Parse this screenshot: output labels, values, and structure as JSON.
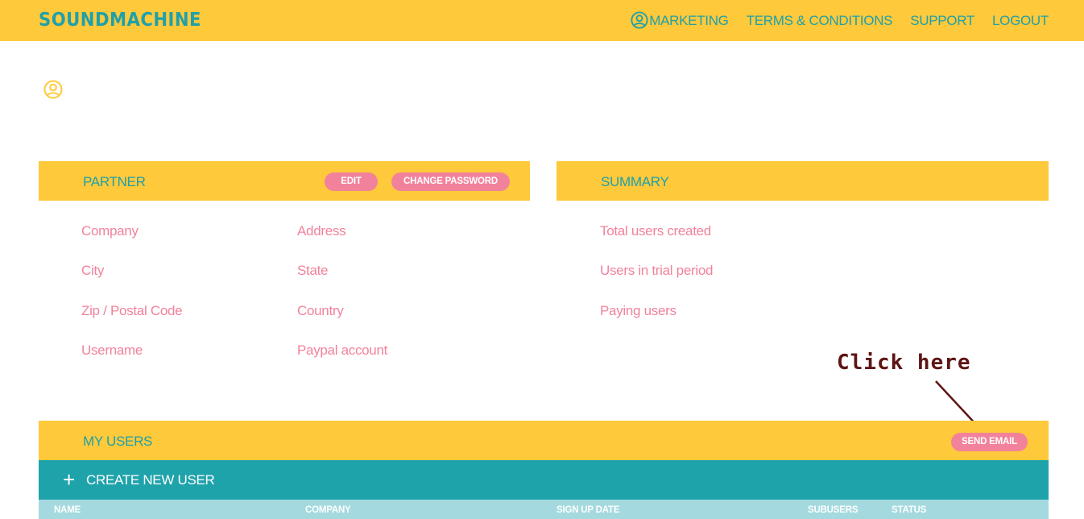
{
  "header": {
    "brand": "SOUNDMACHINE",
    "nav": {
      "marketing": "MARKETING",
      "terms": "TERMS & CONDITIONS",
      "support": "SUPPORT",
      "logout": "LOGOUT"
    }
  },
  "partner": {
    "title": "PARTNER",
    "edit_label": "EDIT",
    "change_password_label": "CHANGE PASSWORD",
    "fields": {
      "company": "Company",
      "address": "Address",
      "city": "City",
      "state": "State",
      "zip": "Zip / Postal Code",
      "country": "Country",
      "username": "Username",
      "paypal": "Paypal account"
    }
  },
  "summary": {
    "title": "SUMMARY",
    "fields": {
      "total_users": "Total users created",
      "trial_users": "Users in trial period",
      "paying_users": "Paying users"
    }
  },
  "annotation": {
    "text": "Click here"
  },
  "my_users": {
    "title": "MY USERS",
    "send_email_label": "SEND EMAIL",
    "create_label": "CREATE NEW USER",
    "create_icon": "+",
    "columns": {
      "name": "NAME",
      "company": "COMPANY",
      "signup": "SIGN UP DATE",
      "subusers": "SUBUSERS",
      "status": "STATUS"
    }
  },
  "colors": {
    "header_bg": "#fec93a",
    "teal": "#1fa0aa",
    "pink": "#f2829b",
    "table_head_bg": "#a4dadf",
    "annotation": "#5e1414"
  }
}
